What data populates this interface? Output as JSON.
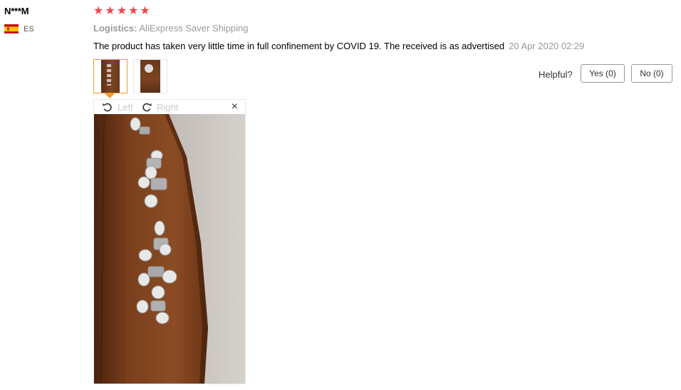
{
  "review": {
    "user_name": "N***M",
    "country_code": "ES",
    "rating_stars": [
      "★",
      "★",
      "★",
      "★",
      "★"
    ],
    "rating": 5,
    "logistics_label": "Logistics:",
    "logistics_value": "AliExpress Saver Shipping",
    "feedback_text": "The product has taken very little time in full confinement by COVID 19. The received is as advertised",
    "date": "20 Apr 2020 02:29"
  },
  "helpful": {
    "label": "Helpful?",
    "yes_label": "Yes (0)",
    "no_label": "No (0)"
  },
  "viewer": {
    "rotate_left_label": "Left",
    "rotate_right_label": "Right",
    "close_label": "×"
  },
  "colors": {
    "star": "#f0464f",
    "active_border": "#f49b2c",
    "muted_text": "#999999"
  }
}
